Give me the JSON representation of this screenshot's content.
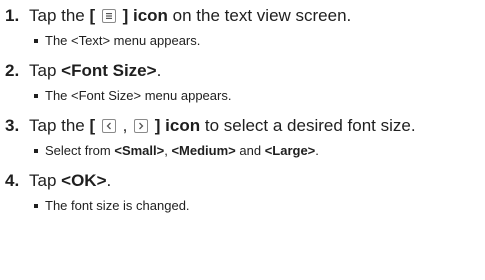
{
  "steps": [
    {
      "number": "1.",
      "pre": "Tap the ",
      "bold_open": "[ ",
      "icon": "menu-list-icon",
      "bold_close": " ] icon",
      "post": " on the text view screen.",
      "note": "The <Text> menu appears."
    },
    {
      "number": "2.",
      "pre": "Tap ",
      "bold": "<Font Size>",
      "post": ".",
      "note": "The <Font Size> menu appears."
    },
    {
      "number": "3.",
      "pre": "Tap the ",
      "bold_open": "[ ",
      "icon_left": "chevron-left-icon",
      "separator": " , ",
      "icon_right": "chevron-right-icon",
      "bold_close": " ] icon",
      "post": " to select a desired font size.",
      "note_pre": "Select from ",
      "note_b1": "<Small>",
      "note_mid1": ", ",
      "note_b2": "<Medium>",
      "note_mid2": " and ",
      "note_b3": "<Large>",
      "note_post": "."
    },
    {
      "number": "4.",
      "pre": "Tap ",
      "bold": "<OK>",
      "post": ".",
      "note": "The font size is changed."
    }
  ]
}
